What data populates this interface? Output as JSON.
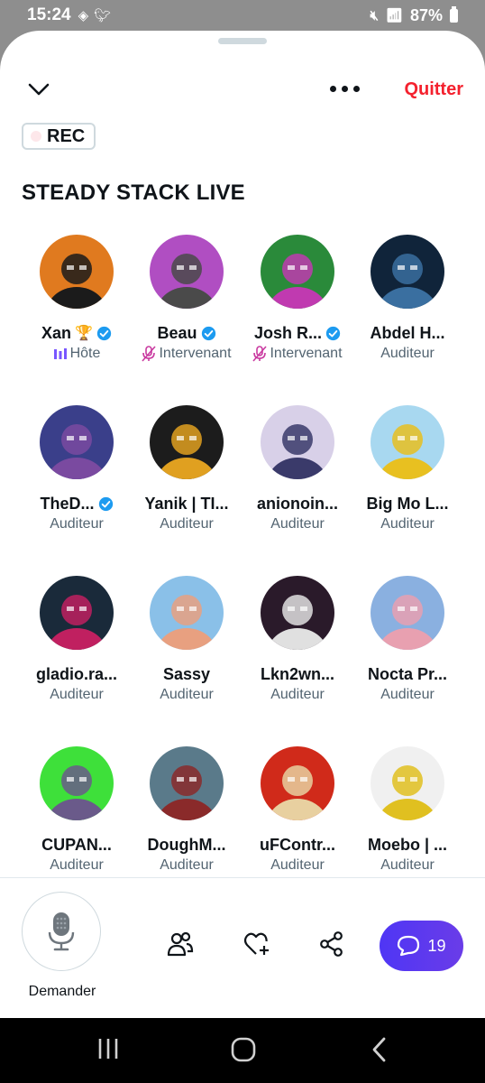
{
  "status": {
    "time": "15:24",
    "battery": "87%"
  },
  "header": {
    "quit_label": "Quitter",
    "rec_label": "REC"
  },
  "space": {
    "title": "STEADY STACK LIVE"
  },
  "participants": [
    {
      "name": "Xan",
      "role": "Hôte",
      "badge": "trophy",
      "verified": true,
      "avatar_colors": [
        "#e07a1f",
        "#1b1b1b"
      ]
    },
    {
      "name": "Beau",
      "role": "Intervenant",
      "verified": true,
      "muted": true,
      "avatar_colors": [
        "#b04ec2",
        "#4a4a4a"
      ]
    },
    {
      "name": "Josh R...",
      "role": "Intervenant",
      "verified": true,
      "muted": true,
      "avatar_colors": [
        "#2a8a3a",
        "#c03ab0"
      ]
    },
    {
      "name": "Abdel H...",
      "role": "Auditeur",
      "avatar_colors": [
        "#10243a",
        "#3a6fa0"
      ]
    },
    {
      "name": "TheD...",
      "role": "Auditeur",
      "verified": true,
      "avatar_colors": [
        "#3a3f8a",
        "#7a4aa0"
      ]
    },
    {
      "name": "Yanik | TI...",
      "role": "Auditeur",
      "avatar_colors": [
        "#1c1c1c",
        "#e0a020"
      ]
    },
    {
      "name": "anionoin...",
      "role": "Auditeur",
      "avatar_colors": [
        "#d8d0e8",
        "#3a3a6a"
      ]
    },
    {
      "name": "Big Mo L...",
      "role": "Auditeur",
      "avatar_colors": [
        "#a8d8f0",
        "#e8c020"
      ]
    },
    {
      "name": "gladio.ra...",
      "role": "Auditeur",
      "avatar_colors": [
        "#1a2a3a",
        "#c02060"
      ]
    },
    {
      "name": "Sassy",
      "role": "Auditeur",
      "avatar_colors": [
        "#8ac0e8",
        "#e8a080"
      ]
    },
    {
      "name": "Lkn2wn...",
      "role": "Auditeur",
      "avatar_colors": [
        "#2a1a2a",
        "#e0e0e0"
      ]
    },
    {
      "name": "Nocta Pr...",
      "role": "Auditeur",
      "avatar_colors": [
        "#8ab0e0",
        "#e8a0b0"
      ]
    },
    {
      "name": "CUPAN...",
      "role": "Auditeur",
      "avatar_colors": [
        "#3ee03a",
        "#6a5a8a"
      ]
    },
    {
      "name": "DoughM...",
      "role": "Auditeur",
      "avatar_colors": [
        "#5a7a8a",
        "#8a2a2a"
      ]
    },
    {
      "name": "uFContr...",
      "role": "Auditeur",
      "avatar_colors": [
        "#d02a1a",
        "#e8d0a0"
      ]
    },
    {
      "name": "Moebo | ...",
      "role": "Auditeur",
      "avatar_colors": [
        "#f0f0f0",
        "#e0c020"
      ]
    }
  ],
  "bottom": {
    "request_label": "Demander",
    "comments_count": "19"
  },
  "colors": {
    "accent": "#f4212e",
    "verified": "#1d9bf0",
    "chat": "#5b34f0",
    "host": "#7856ff",
    "speaker": "#c93aa0"
  }
}
